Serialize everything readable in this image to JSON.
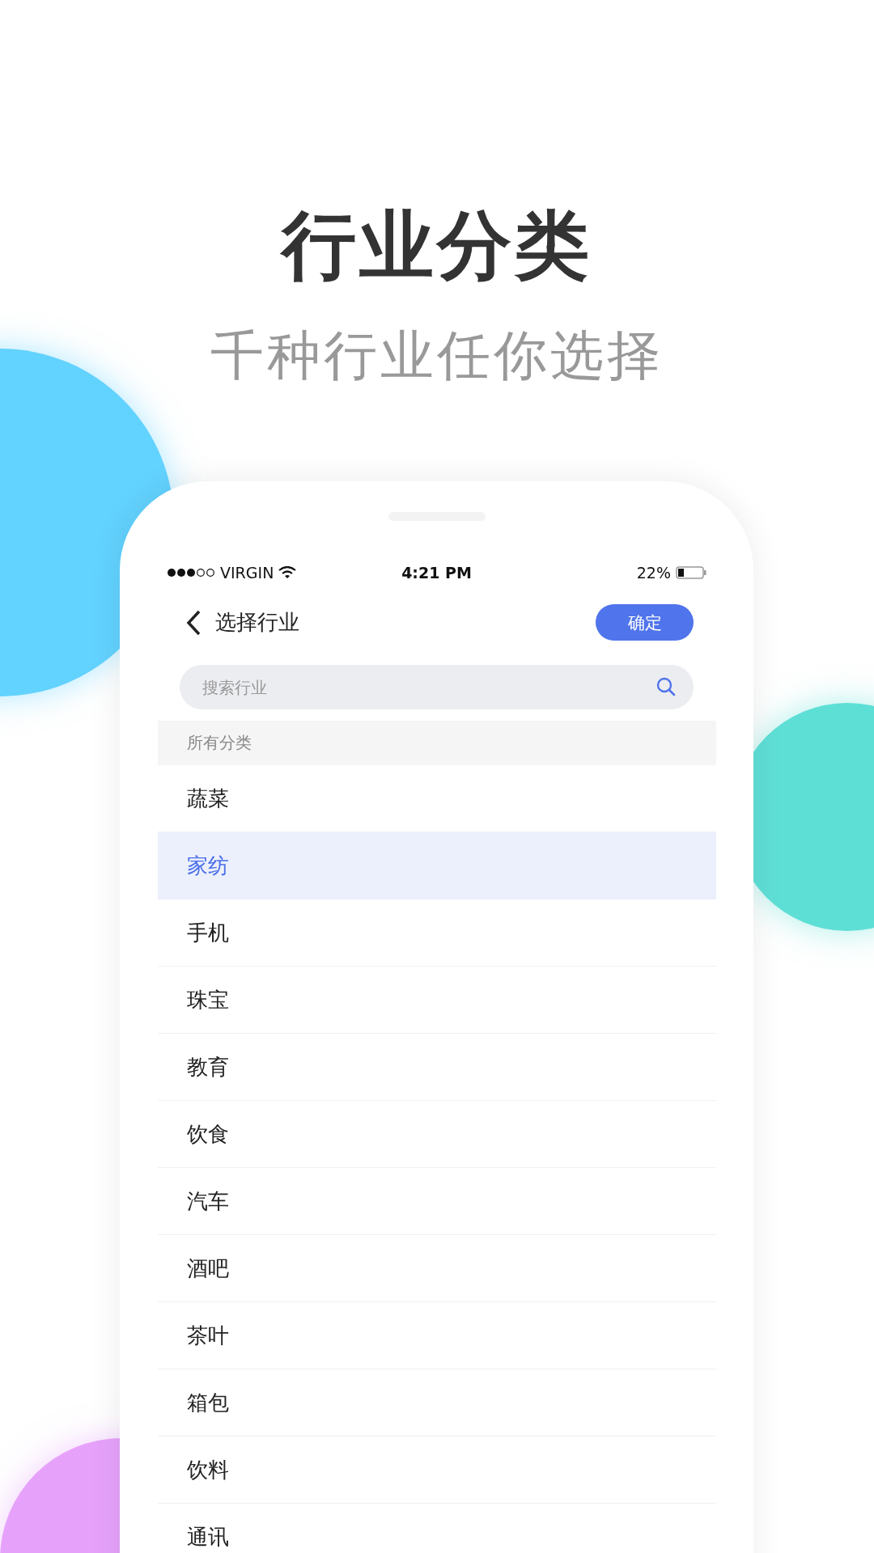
{
  "heading": {
    "title": "行业分类",
    "subtitle": "千种行业任你选择"
  },
  "status_bar": {
    "carrier": "VIRGIN",
    "time": "4:21 PM",
    "battery": "22%"
  },
  "header": {
    "title": "选择行业",
    "confirm_button": "确定"
  },
  "search": {
    "placeholder": "搜索行业"
  },
  "section_label": "所有分类",
  "items": [
    {
      "label": "蔬菜",
      "selected": false
    },
    {
      "label": "家纺",
      "selected": true
    },
    {
      "label": "手机",
      "selected": false
    },
    {
      "label": "珠宝",
      "selected": false
    },
    {
      "label": "教育",
      "selected": false
    },
    {
      "label": "饮食",
      "selected": false
    },
    {
      "label": "汽车",
      "selected": false
    },
    {
      "label": "酒吧",
      "selected": false
    },
    {
      "label": "茶叶",
      "selected": false
    },
    {
      "label": "箱包",
      "selected": false
    },
    {
      "label": "饮料",
      "selected": false
    },
    {
      "label": "通讯",
      "selected": false
    }
  ]
}
